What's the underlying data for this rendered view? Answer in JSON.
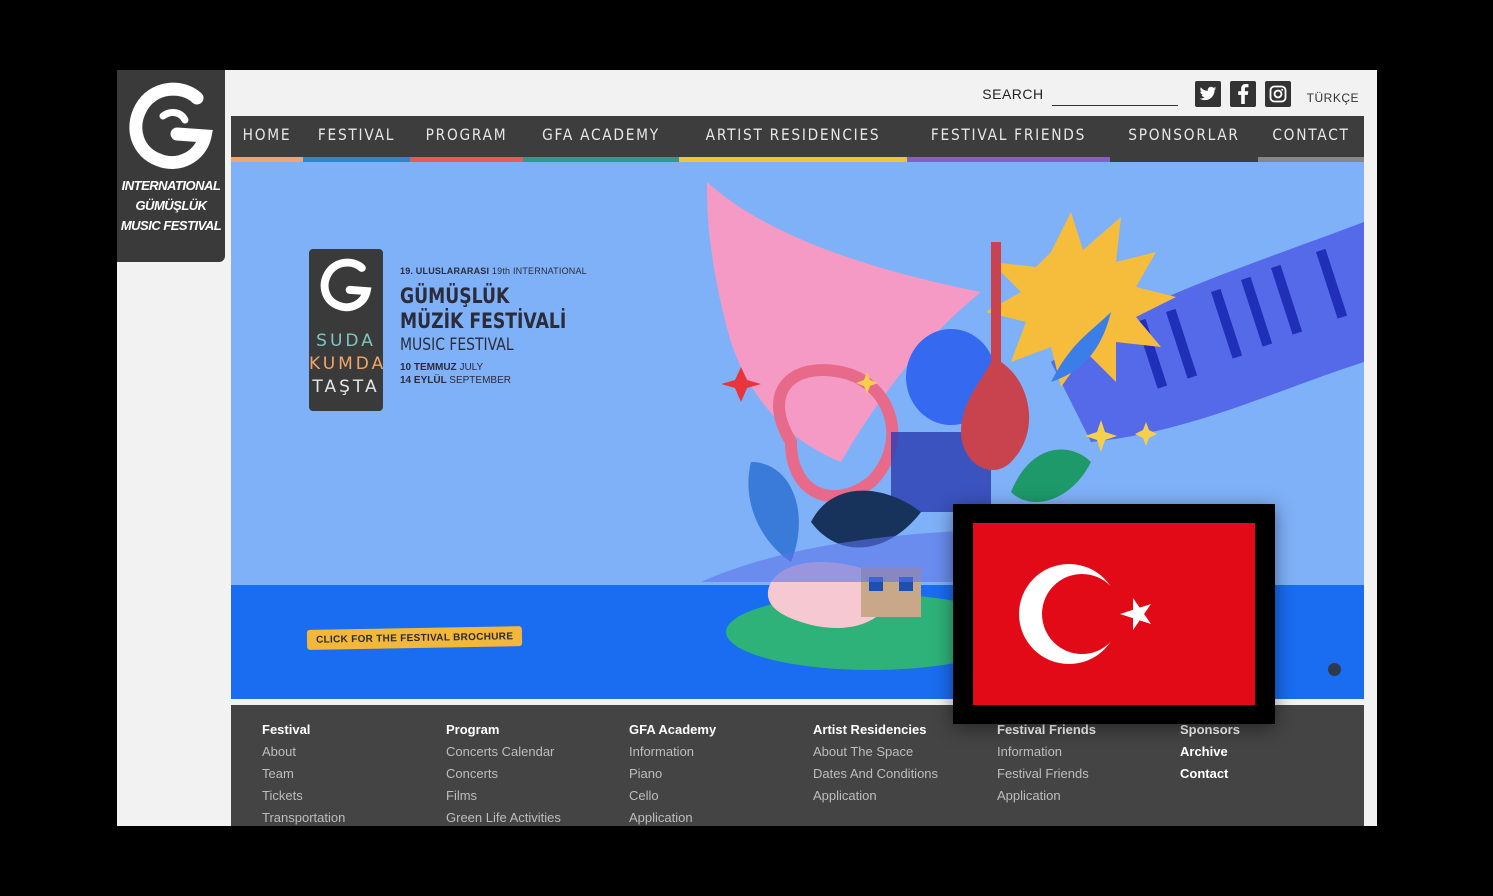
{
  "logo": {
    "lines": [
      "INTERNATIONAL",
      "GÜMÜŞLÜK",
      "MUSIC FESTIVAL"
    ]
  },
  "topbar": {
    "search_label": "SEARCH",
    "search_value": "",
    "language": "TÜRKÇE",
    "social": [
      "twitter-icon",
      "facebook-icon",
      "instagram-icon"
    ]
  },
  "nav": {
    "items": [
      {
        "label": "HOME",
        "color": "#f2a46a"
      },
      {
        "label": "FESTIVAL",
        "color": "#2f86c9"
      },
      {
        "label": "PROGRAM",
        "color": "#e8595a"
      },
      {
        "label": "GFA ACADEMY",
        "color": "#2f9a8a"
      },
      {
        "label": "ARTIST RESIDENCIES",
        "color": "#f2c434"
      },
      {
        "label": "FESTIVAL FRIENDS",
        "color": "#8a5cc8"
      },
      {
        "label": "SPONSORLAR",
        "color": "#3d3d3d"
      },
      {
        "label": "CONTACT",
        "color": "#888888"
      }
    ]
  },
  "hero": {
    "logo_words": [
      "SUDA",
      "KUMDA",
      "TAŞTA"
    ],
    "logo_word_colors": [
      "#7cc7c0",
      "#f2a46a",
      "#e6e6e6"
    ],
    "edition": "19. ULUSLARARASI",
    "edition_en": "19th INTERNATIONAL",
    "title1": "GÜMÜŞLÜK",
    "title2": "MÜZİK FESTİVALİ",
    "title3": "MUSIC FESTIVAL",
    "date1": "10 TEMMUZ",
    "date1_en": "JULY",
    "date2": "14 EYLÜL",
    "date2_en": "SEPTEMBER",
    "brochure": "CLICK FOR THE FESTIVAL BROCHURE"
  },
  "footer": {
    "columns": [
      {
        "head": "Festival",
        "items": [
          "About",
          "Team",
          "Tickets",
          "Transportation"
        ]
      },
      {
        "head": "Program",
        "items": [
          "Concerts Calendar",
          "Concerts",
          "Films",
          "Green Life Activities"
        ]
      },
      {
        "head": "GFA Academy",
        "items": [
          "Information",
          "Piano",
          "Cello",
          "Application"
        ]
      },
      {
        "head": "Artist Residencies",
        "items": [
          "About The Space",
          "Dates And Conditions",
          "Application"
        ]
      },
      {
        "head": "Festival Friends",
        "items": [
          "Information",
          "Festival Friends",
          "Application"
        ]
      },
      {
        "head": "Sponsors",
        "items": [
          "Archive",
          "Contact"
        ]
      }
    ]
  }
}
